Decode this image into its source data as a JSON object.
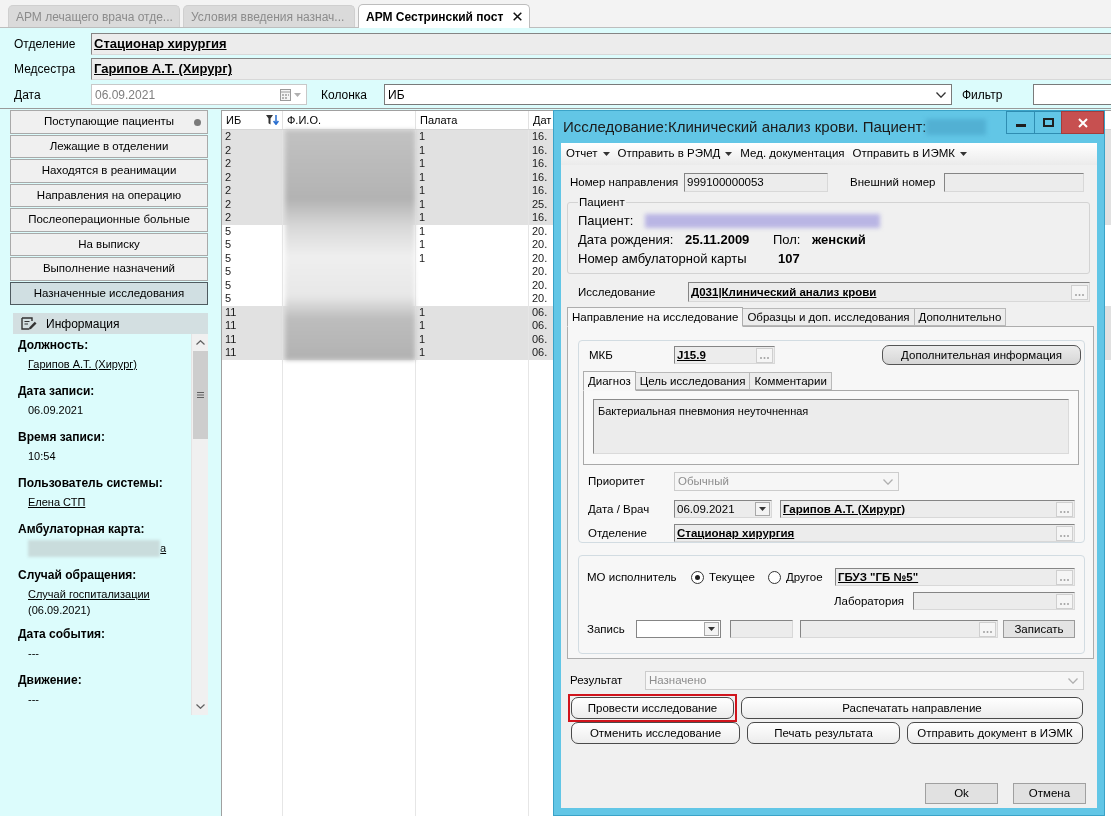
{
  "tabs": [
    {
      "label": "АРМ лечащего врача отде...",
      "selected": false,
      "closable": false
    },
    {
      "label": "Условия введения назнач...",
      "selected": false,
      "closable": false
    },
    {
      "label": "АРМ Сестринский пост",
      "selected": true,
      "closable": true
    }
  ],
  "header": {
    "department": {
      "label": "Отделение",
      "value": "Стационар хирургия"
    },
    "nurse": {
      "label": "Медсестра",
      "value": "Гарипов А.Т. (Хирург)"
    },
    "date": {
      "label": "Дата",
      "value": "06.09.2021",
      "disabled": true
    },
    "column": {
      "label": "Колонка",
      "value": "ИБ"
    },
    "filter": {
      "label": "Фильтр"
    }
  },
  "nav": [
    {
      "label": "Поступающие пациенты",
      "selected": false,
      "indicator": true
    },
    {
      "label": "Лежащие в отделении",
      "selected": false,
      "indicator": false
    },
    {
      "label": "Находятся в реанимации",
      "selected": false,
      "indicator": false
    },
    {
      "label": "Направления на операцию",
      "selected": false,
      "indicator": false
    },
    {
      "label": "Послеоперационные больные",
      "selected": false,
      "indicator": false
    },
    {
      "label": "На выписку",
      "selected": false,
      "indicator": false
    },
    {
      "label": "Выполнение назначений",
      "selected": false,
      "indicator": false
    },
    {
      "label": "Назначенные исследования",
      "selected": true,
      "indicator": false
    }
  ],
  "info": {
    "title": "Информация",
    "items": [
      {
        "label": "Должность:",
        "value": "Гарипов А.Т. (Хирург)",
        "link": true,
        "blurred": false
      },
      {
        "label": "Дата записи:",
        "value": "06.09.2021",
        "link": false,
        "blurred": false
      },
      {
        "label": "Время записи:",
        "value": "10:54",
        "link": false,
        "blurred": false
      },
      {
        "label": "Пользователь системы:",
        "value": "Елена СТП",
        "link": true,
        "blurred": false
      },
      {
        "label": "Амбулаторная карта:",
        "value": "а",
        "link": true,
        "blurred": true
      },
      {
        "label": "Случай обращения:",
        "value": "Случай госпитализации",
        "link": true,
        "blurred": false,
        "note": "(06.09.2021)"
      },
      {
        "label": "Дата события:",
        "value": "---",
        "link": false,
        "blurred": false
      },
      {
        "label": "Движение:",
        "value": "---",
        "link": false,
        "blurred": false
      }
    ]
  },
  "table": {
    "columns": [
      {
        "label": "ИБ",
        "filter": true
      },
      {
        "label": "Ф.И.О."
      },
      {
        "label": "Палата"
      },
      {
        "label": "Дат"
      }
    ],
    "rows": [
      {
        "ib": "2",
        "ward": "1",
        "date": "16.",
        "shaded": true
      },
      {
        "ib": "2",
        "ward": "1",
        "date": "16.",
        "shaded": true
      },
      {
        "ib": "2",
        "ward": "1",
        "date": "16.",
        "shaded": true
      },
      {
        "ib": "2",
        "ward": "1",
        "date": "16.",
        "shaded": true
      },
      {
        "ib": "2",
        "ward": "1",
        "date": "16.",
        "shaded": true
      },
      {
        "ib": "2",
        "ward": "1",
        "date": "25.",
        "shaded": true
      },
      {
        "ib": "2",
        "ward": "1",
        "date": "16.",
        "shaded": true
      },
      {
        "ib": "5",
        "ward": "1",
        "date": "20.",
        "shaded": false
      },
      {
        "ib": "5",
        "ward": "1",
        "date": "20.",
        "shaded": false
      },
      {
        "ib": "5",
        "ward": "1",
        "date": "20.",
        "shaded": false
      },
      {
        "ib": "5",
        "date": "20.",
        "shaded": false
      },
      {
        "ib": "5",
        "date": "20.",
        "shaded": false
      },
      {
        "ib": "5",
        "date": "20.",
        "shaded": false
      },
      {
        "ib": "11",
        "ward": "1",
        "date": "06.",
        "shaded": true
      },
      {
        "ib": "11",
        "ward": "1",
        "date": "06.",
        "shaded": true
      },
      {
        "ib": "11",
        "ward": "1",
        "date": "06.",
        "shaded": true
      },
      {
        "ib": "11",
        "ward": "1",
        "date": "06.",
        "shaded": true
      }
    ]
  },
  "dialog": {
    "title": "Исследование:Клинический анализ крови. Пациент:",
    "menu": [
      {
        "label": "Отчет",
        "dropdown": true
      },
      {
        "label": "Отправить в РЭМД",
        "dropdown": true
      },
      {
        "label": "Мед. документация",
        "dropdown": false
      },
      {
        "label": "Отправить в ИЭМК",
        "dropdown": true
      }
    ],
    "referral_number": {
      "label": "Номер направления",
      "value": "999100000053"
    },
    "external_number": {
      "label": "Внешний номер"
    },
    "patient": {
      "title": "Пациент",
      "name_label": "Пациент:",
      "birth_label": "Дата рождения:",
      "birth": "25.11.2009",
      "sex_label": "Пол:",
      "sex": "женский",
      "card_label": "Номер амбулаторной карты",
      "card": "107"
    },
    "study": {
      "label": "Исследование",
      "value": "Д031|Клинический анализ крови"
    },
    "tabs": [
      {
        "label": "Направление на исследование",
        "selected": true
      },
      {
        "label": "Образцы и доп. исследования",
        "selected": false
      },
      {
        "label": "Дополнительно",
        "selected": false
      }
    ],
    "mkb": {
      "label": "МКБ",
      "value": "J15.9"
    },
    "extra_info_button": "Дополнительная информация",
    "inner_tabs": [
      {
        "label": "Диагноз",
        "selected": true
      },
      {
        "label": "Цель исследования",
        "selected": false
      },
      {
        "label": "Комментарии",
        "selected": false
      }
    ],
    "diagnosis": "Бактериальная пневмония неуточненная",
    "priority": {
      "label": "Приоритет",
      "value": "Обычный",
      "disabled": true
    },
    "date_doctor": {
      "label": "Дата / Врач",
      "date": "06.09.2021",
      "doctor": "Гарипов А.Т. (Хирург)"
    },
    "department": {
      "label": "Отделение",
      "value": "Стационар хирургия"
    },
    "executor": {
      "label": "МО исполнитель",
      "options": [
        {
          "label": "Текущее",
          "selected": true
        },
        {
          "label": "Другое",
          "selected": false
        }
      ],
      "value": "ГБУЗ \"ГБ №5\""
    },
    "lab": {
      "label": "Лаборатория"
    },
    "record": {
      "label": "Запись",
      "button": "Записать"
    },
    "result": {
      "label": "Результат",
      "value": "Назначено",
      "disabled": true
    },
    "action_rows": [
      [
        {
          "label": "Провести исследование",
          "highlighted": true
        },
        {
          "label": "Распечатать направление",
          "highlighted": false
        }
      ],
      [
        {
          "label": "Отменить исследование",
          "highlighted": false
        },
        {
          "label": "Печать результата",
          "highlighted": false
        },
        {
          "label": "Отправить документ в ИЭМК",
          "highlighted": false
        }
      ]
    ],
    "footer_buttons": [
      "Ok",
      "Отмена"
    ]
  }
}
